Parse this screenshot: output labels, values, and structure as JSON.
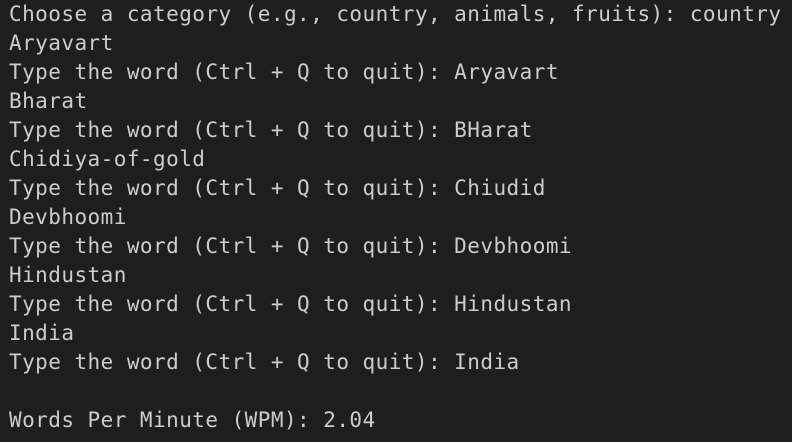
{
  "terminal": {
    "lines": [
      "Choose a category (e.g., country, animals, fruits): country",
      "Aryavart",
      "Type the word (Ctrl + Q to quit): Aryavart",
      "Bharat",
      "Type the word (Ctrl + Q to quit): BHarat",
      "Chidiya-of-gold",
      "Type the word (Ctrl + Q to quit): Chiudid",
      "Devbhoomi",
      "Type the word (Ctrl + Q to quit): Devbhoomi",
      "Hindustan",
      "Type the word (Ctrl + Q to quit): Hindustan",
      "India",
      "Type the word (Ctrl + Q to quit): India",
      "",
      "Words Per Minute (WPM): 2.04"
    ]
  },
  "colors": {
    "background": "#1e1e1e",
    "text": "#cccccc"
  }
}
